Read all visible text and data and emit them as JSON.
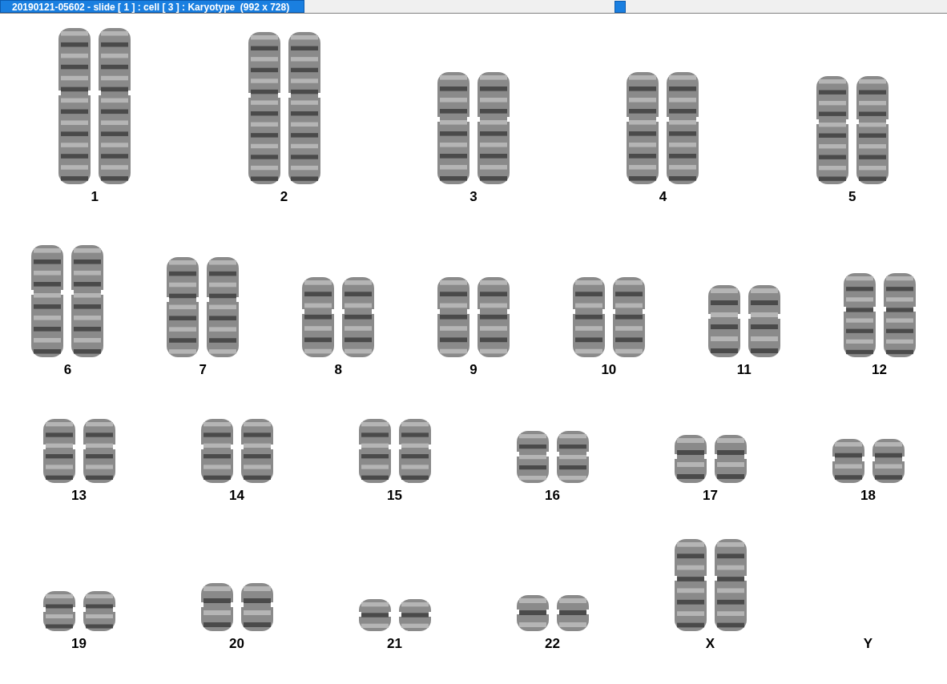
{
  "window": {
    "title": "20190121-05602 - slide [ 1 ] : cell [ 3 ] : Karyotype  (992 x 728)"
  },
  "rows": [
    {
      "items": [
        {
          "label": "1",
          "kind": "pair"
        },
        {
          "label": "2",
          "kind": "pair"
        },
        {
          "label": "3",
          "kind": "pair"
        },
        {
          "label": "4",
          "kind": "pair"
        },
        {
          "label": "5",
          "kind": "pair"
        }
      ]
    },
    {
      "items": [
        {
          "label": "6",
          "kind": "pair"
        },
        {
          "label": "7",
          "kind": "pair"
        },
        {
          "label": "8",
          "kind": "pair"
        },
        {
          "label": "9",
          "kind": "pair"
        },
        {
          "label": "10",
          "kind": "pair"
        },
        {
          "label": "11",
          "kind": "pair"
        },
        {
          "label": "12",
          "kind": "pair"
        }
      ]
    },
    {
      "items": [
        {
          "label": "13",
          "kind": "pair"
        },
        {
          "label": "14",
          "kind": "pair"
        },
        {
          "label": "15",
          "kind": "pair"
        },
        {
          "label": "16",
          "kind": "pair"
        },
        {
          "label": "17",
          "kind": "pair"
        },
        {
          "label": "18",
          "kind": "pair"
        }
      ]
    },
    {
      "items": [
        {
          "label": "19",
          "kind": "pair"
        },
        {
          "label": "20",
          "kind": "pair"
        },
        {
          "label": "21",
          "kind": "pair"
        },
        {
          "label": "22",
          "kind": "pair"
        },
        {
          "label": "X",
          "kind": "pair"
        },
        {
          "label": "Y",
          "kind": "none"
        }
      ]
    }
  ]
}
